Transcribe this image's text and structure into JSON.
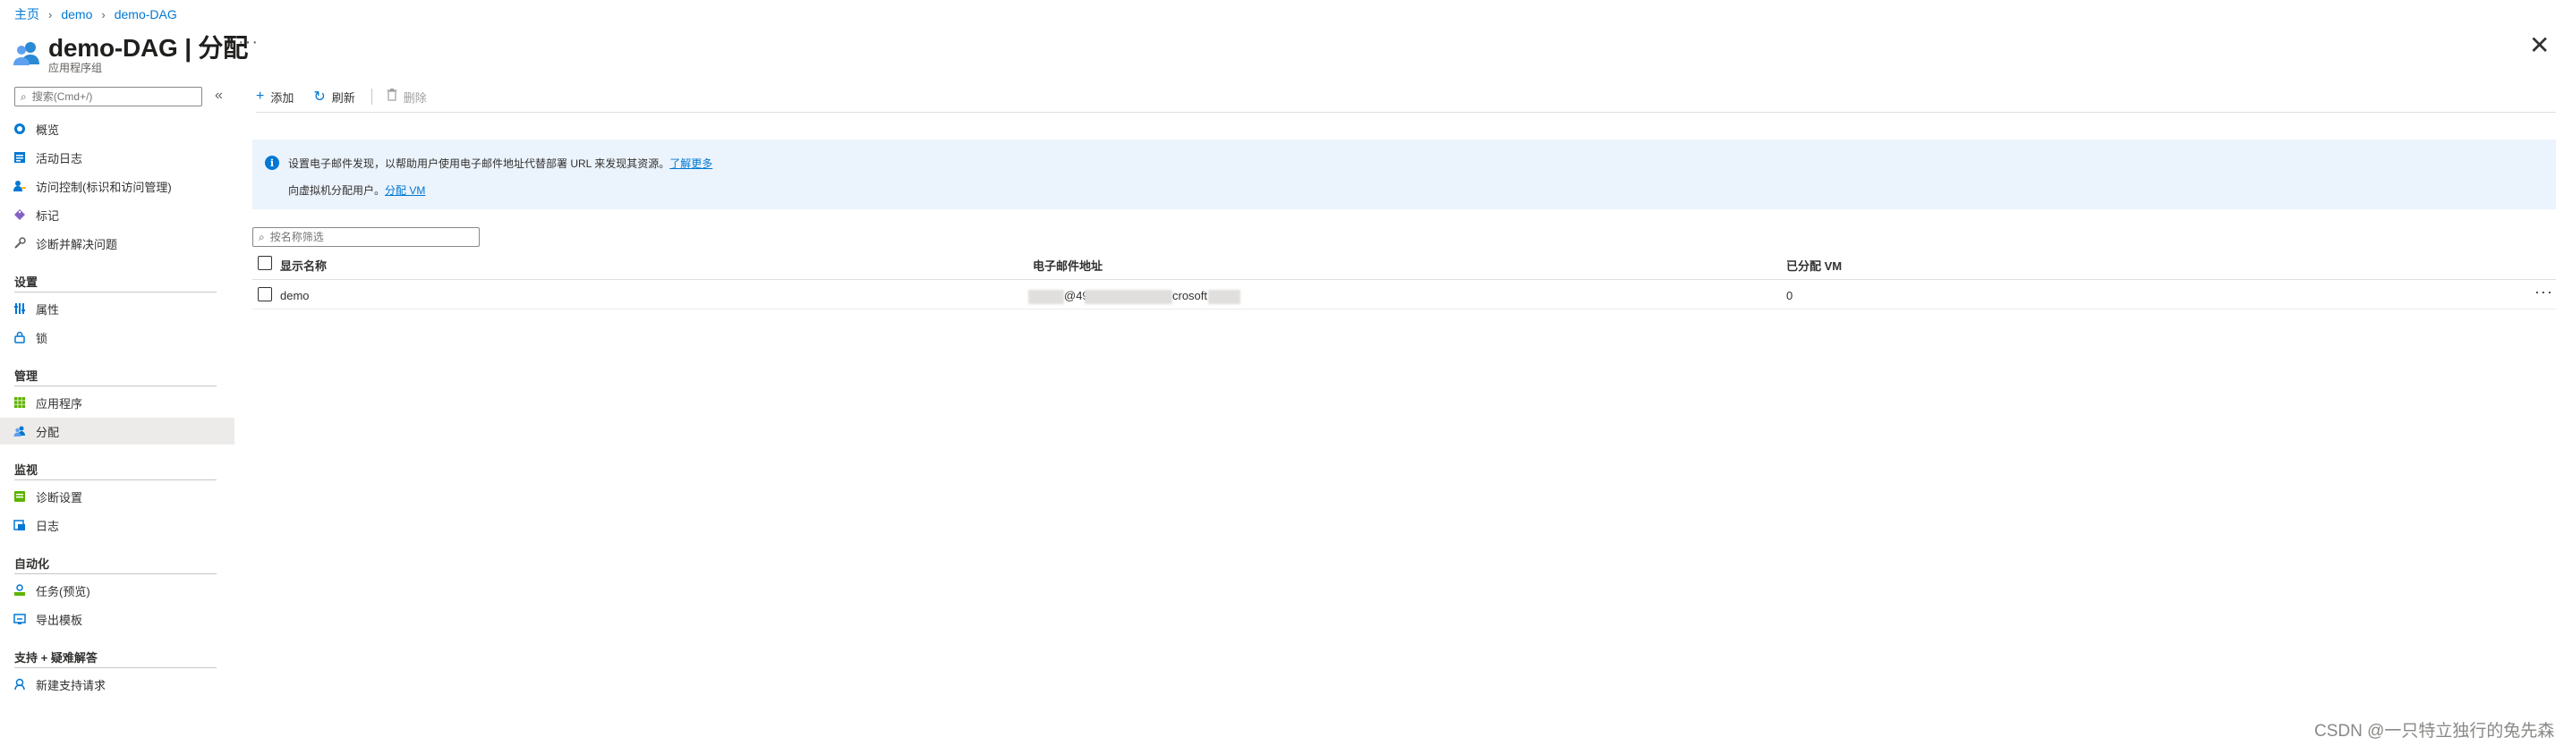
{
  "breadcrumb": {
    "home": "主页",
    "item1": "demo",
    "item2": "demo-DAG"
  },
  "header": {
    "title": "demo-DAG | 分配",
    "subtitle": "应用程序组",
    "more": "···",
    "close": "✕"
  },
  "sidebar": {
    "search_placeholder": "搜索(Cmd+/)",
    "collapse": "«",
    "items": [
      {
        "label": "概览",
        "icon": "overview-icon"
      },
      {
        "label": "活动日志",
        "icon": "activity-log-icon"
      },
      {
        "label": "访问控制(标识和访问管理)",
        "icon": "access-control-icon"
      },
      {
        "label": "标记",
        "icon": "tag-icon"
      },
      {
        "label": "诊断并解决问题",
        "icon": "wrench-icon"
      }
    ],
    "sections": [
      {
        "title": "设置",
        "items": [
          {
            "label": "属性",
            "icon": "properties-icon"
          },
          {
            "label": "锁",
            "icon": "lock-icon"
          }
        ]
      },
      {
        "title": "管理",
        "items": [
          {
            "label": "应用程序",
            "icon": "applications-icon"
          },
          {
            "label": "分配",
            "icon": "assignments-icon",
            "selected": true
          }
        ]
      },
      {
        "title": "监视",
        "items": [
          {
            "label": "诊断设置",
            "icon": "diagnostic-settings-icon"
          },
          {
            "label": "日志",
            "icon": "logs-icon"
          }
        ]
      },
      {
        "title": "自动化",
        "items": [
          {
            "label": "任务(预览)",
            "icon": "tasks-icon"
          },
          {
            "label": "导出模板",
            "icon": "export-template-icon"
          }
        ]
      },
      {
        "title": "支持 + 疑难解答",
        "items": [
          {
            "label": "新建支持请求",
            "icon": "support-request-icon"
          }
        ]
      }
    ]
  },
  "toolbar": {
    "add": "添加",
    "refresh": "刷新",
    "delete": "删除"
  },
  "banner": {
    "line1": "设置电子邮件发现，以帮助用户使用电子邮件地址代替部署 URL 来发现其资源。",
    "line1_link": "了解更多",
    "line2": "向虚拟机分配用户。",
    "line2_link": "分配 VM"
  },
  "filter": {
    "placeholder": "按名称筛选"
  },
  "table": {
    "columns": [
      "显示名称",
      "电子邮件地址",
      "已分配 VM"
    ],
    "rows": [
      {
        "name": "demo",
        "email_visible_a": "@49",
        "email_visible_b": "crosoft",
        "vms": "0"
      }
    ],
    "row_more": "···"
  },
  "watermark": "CSDN @一只特立独行的兔先森",
  "colors": {
    "accent": "#0078d4",
    "selected_bg": "#edebe9",
    "banner_bg": "#ebf3fc"
  }
}
